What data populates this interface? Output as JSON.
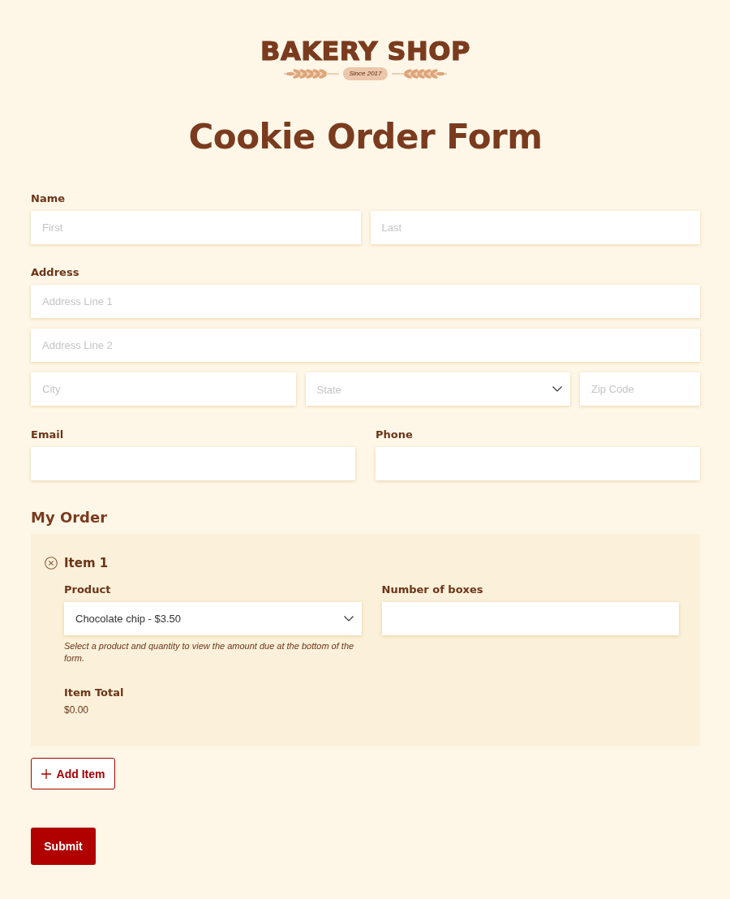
{
  "logo": {
    "text": "BAKERY SHOP",
    "tagline": "Since 2017"
  },
  "title": "Cookie Order Form",
  "name_section": {
    "label": "Name",
    "inputs": [
      {
        "placeholder": "First"
      },
      {
        "placeholder": "Last"
      }
    ]
  },
  "address_section": {
    "label": "Address",
    "rows": [
      [
        {
          "kind": "text",
          "placeholder": "Address Line 1"
        }
      ],
      [
        {
          "kind": "text",
          "placeholder": "Address Line 2"
        }
      ],
      [
        {
          "kind": "text",
          "placeholder": "City"
        },
        {
          "kind": "select",
          "placeholder": "State"
        },
        {
          "kind": "text",
          "placeholder": "Zip Code"
        }
      ]
    ]
  },
  "contact": [
    {
      "label": "Email"
    },
    {
      "label": "Phone"
    }
  ],
  "order": {
    "heading": "My Order",
    "items": [
      {
        "title": "Item 1",
        "product": {
          "label": "Product",
          "value": "Chocolate chip - $3.50"
        },
        "boxes": {
          "label": "Number of boxes"
        },
        "hint": "Select a product and quantity to view the amount due at the bottom of the form.",
        "total": {
          "label": "Item Total",
          "value": "$0.00"
        }
      }
    ],
    "add_button": "Add Item"
  },
  "submit": "Submit"
}
